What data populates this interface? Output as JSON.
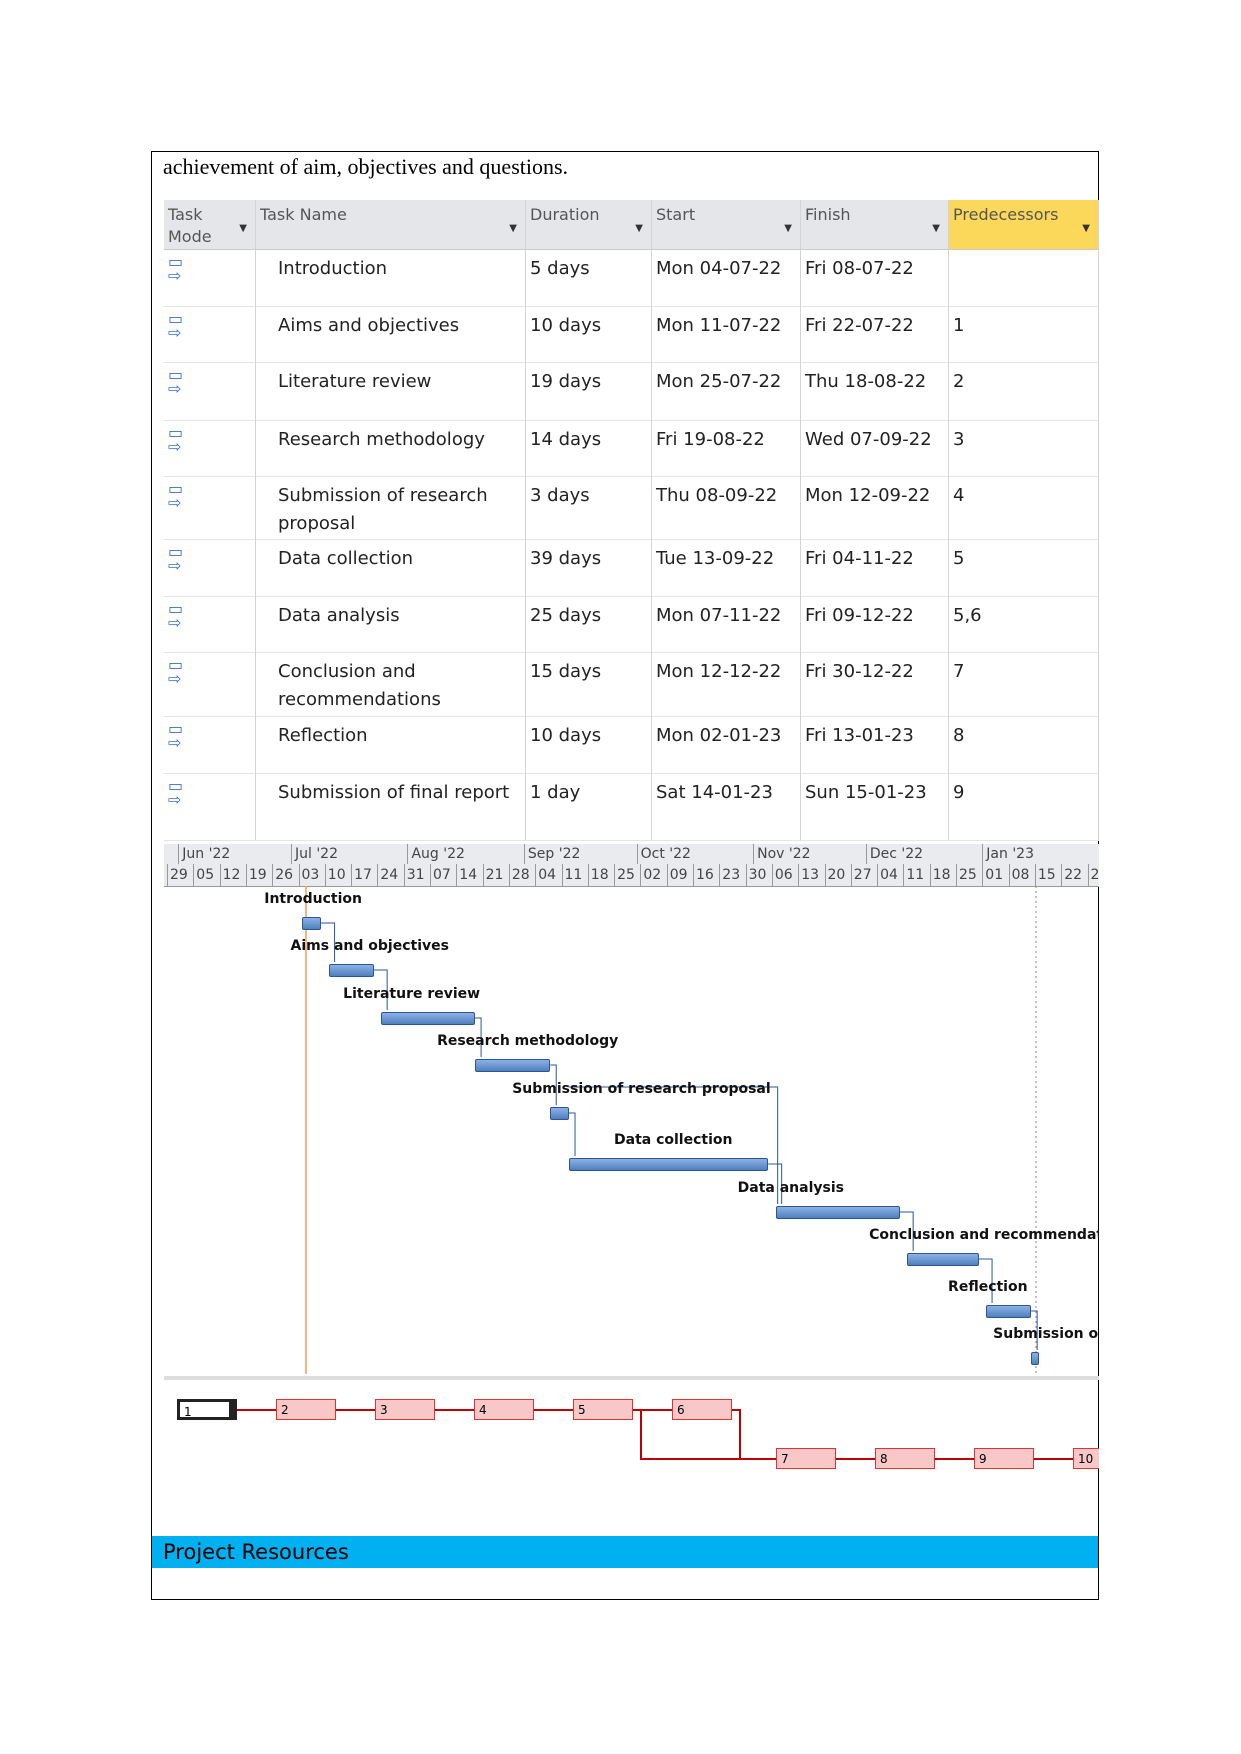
{
  "intro_text": "achievement of aim, objectives and questions.",
  "table": {
    "headers": [
      "Task Mode",
      "Task Name",
      "Duration",
      "Start",
      "Finish",
      "Predecessors"
    ],
    "rows": [
      {
        "name": "Introduction",
        "duration": "5 days",
        "start": "Mon 04-07-22",
        "finish": "Fri 08-07-22",
        "pred": ""
      },
      {
        "name": "Aims and objectives",
        "duration": "10 days",
        "start": "Mon 11-07-22",
        "finish": "Fri 22-07-22",
        "pred": "1"
      },
      {
        "name": "Literature review",
        "duration": "19 days",
        "start": "Mon 25-07-22",
        "finish": "Thu 18-08-22",
        "pred": "2"
      },
      {
        "name": "Research methodology",
        "duration": "14 days",
        "start": "Fri 19-08-22",
        "finish": "Wed 07-09-22",
        "pred": "3"
      },
      {
        "name": "Submission of research proposal",
        "duration": "3 days",
        "start": "Thu 08-09-22",
        "finish": "Mon 12-09-22",
        "pred": "4"
      },
      {
        "name": "Data collection",
        "duration": "39 days",
        "start": "Tue 13-09-22",
        "finish": "Fri 04-11-22",
        "pred": "5"
      },
      {
        "name": "Data analysis",
        "duration": "25 days",
        "start": "Mon 07-11-22",
        "finish": "Fri 09-12-22",
        "pred": "5,6"
      },
      {
        "name": "Conclusion and recommendations",
        "duration": "15 days",
        "start": "Mon 12-12-22",
        "finish": "Fri 30-12-22",
        "pred": "7"
      },
      {
        "name": "Reflection",
        "duration": "10 days",
        "start": "Mon 02-01-23",
        "finish": "Fri 13-01-23",
        "pred": "8"
      },
      {
        "name": "Submission of final report",
        "duration": "1 day",
        "start": "Sat 14-01-23",
        "finish": "Sun 15-01-23",
        "pred": "9"
      }
    ]
  },
  "gantt": {
    "months": [
      "Jun '22",
      "Jul '22",
      "Aug '22",
      "Sep '22",
      "Oct '22",
      "Nov '22",
      "Dec '22",
      "Jan '23"
    ],
    "weeks": [
      "29",
      "05",
      "12",
      "19",
      "26",
      "03",
      "10",
      "17",
      "24",
      "31",
      "07",
      "14",
      "21",
      "28",
      "04",
      "11",
      "18",
      "25",
      "02",
      "09",
      "16",
      "23",
      "30",
      "06",
      "13",
      "20",
      "27",
      "04",
      "11",
      "18",
      "25",
      "01",
      "08",
      "15",
      "22",
      "2"
    ],
    "labels": [
      "Introduction",
      "Aims and objectives",
      "Literature review",
      "Research methodology",
      "Submission of research proposal",
      "Data collection",
      "Data analysis",
      "Conclusion and recommendations",
      "Reflection",
      "Submission of final rep"
    ],
    "bar_color": "#4f81bd",
    "today_color": "#f0a050"
  },
  "network": {
    "nodes": [
      "1",
      "2",
      "3",
      "4",
      "5",
      "6",
      "7",
      "8",
      "9",
      "10"
    ],
    "link_color": "#c00000"
  },
  "section_heading": "Project Resources",
  "section_color": "#00b0f0"
}
